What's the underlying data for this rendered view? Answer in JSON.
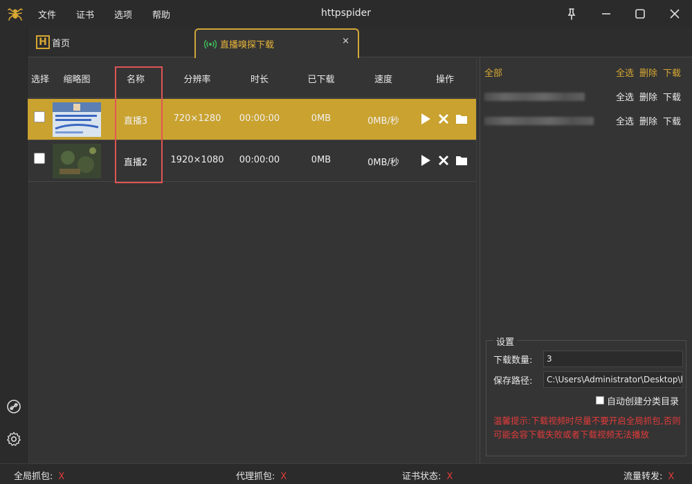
{
  "app": {
    "title": "httpspider"
  },
  "menu": [
    "文件",
    "证书",
    "选项",
    "帮助"
  ],
  "tabs": {
    "home": {
      "badge": "H",
      "label": "首页"
    },
    "active": {
      "label": "直播嗅探下载",
      "close": "×"
    }
  },
  "table": {
    "headers": {
      "select": "选择",
      "thumb": "缩略图",
      "name": "名称",
      "resolution": "分辨率",
      "duration": "时长",
      "downloaded": "已下载",
      "speed": "速度",
      "actions": "操作"
    },
    "rows": [
      {
        "name": "直播3",
        "resolution": "720×1280",
        "duration": "00:00:00",
        "downloaded": "0MB",
        "speed": "0MB/秒",
        "selected": true
      },
      {
        "name": "直播2",
        "resolution": "1920×1080",
        "duration": "00:00:00",
        "downloaded": "0MB",
        "speed": "0MB/秒",
        "selected": false
      }
    ]
  },
  "right_panel": {
    "all_label": "全部",
    "actions": {
      "select_all": "全选",
      "delete": "删除",
      "download": "下载"
    },
    "groups": [
      {
        "select_all": "全选",
        "delete": "删除",
        "download": "下载"
      },
      {
        "select_all": "全选",
        "delete": "删除",
        "download": "下载"
      }
    ]
  },
  "settings": {
    "legend": "设置",
    "download_count_label": "下载数量:",
    "download_count": "3",
    "save_path_label": "保存路径:",
    "save_path": "C:\\Users\\Administrator\\Desktop\\h",
    "auto_dir_label": "自动创建分类目录",
    "tip": "温馨提示:下载视频时尽量不要开启全局抓包,否则可能会容下载失败或者下载视频无法播放"
  },
  "status": {
    "global_capture": {
      "label": "全局抓包:",
      "value": "X"
    },
    "proxy_capture": {
      "label": "代理抓包:",
      "value": "X"
    },
    "cert_status": {
      "label": "证书状态:",
      "value": "X"
    },
    "traffic_forward": {
      "label": "流量转发:",
      "value": "X"
    }
  },
  "colors": {
    "accent": "#d8a733",
    "selected_row": "#c9a22f",
    "error": "#e53b3b",
    "highlight": "#e05555"
  }
}
